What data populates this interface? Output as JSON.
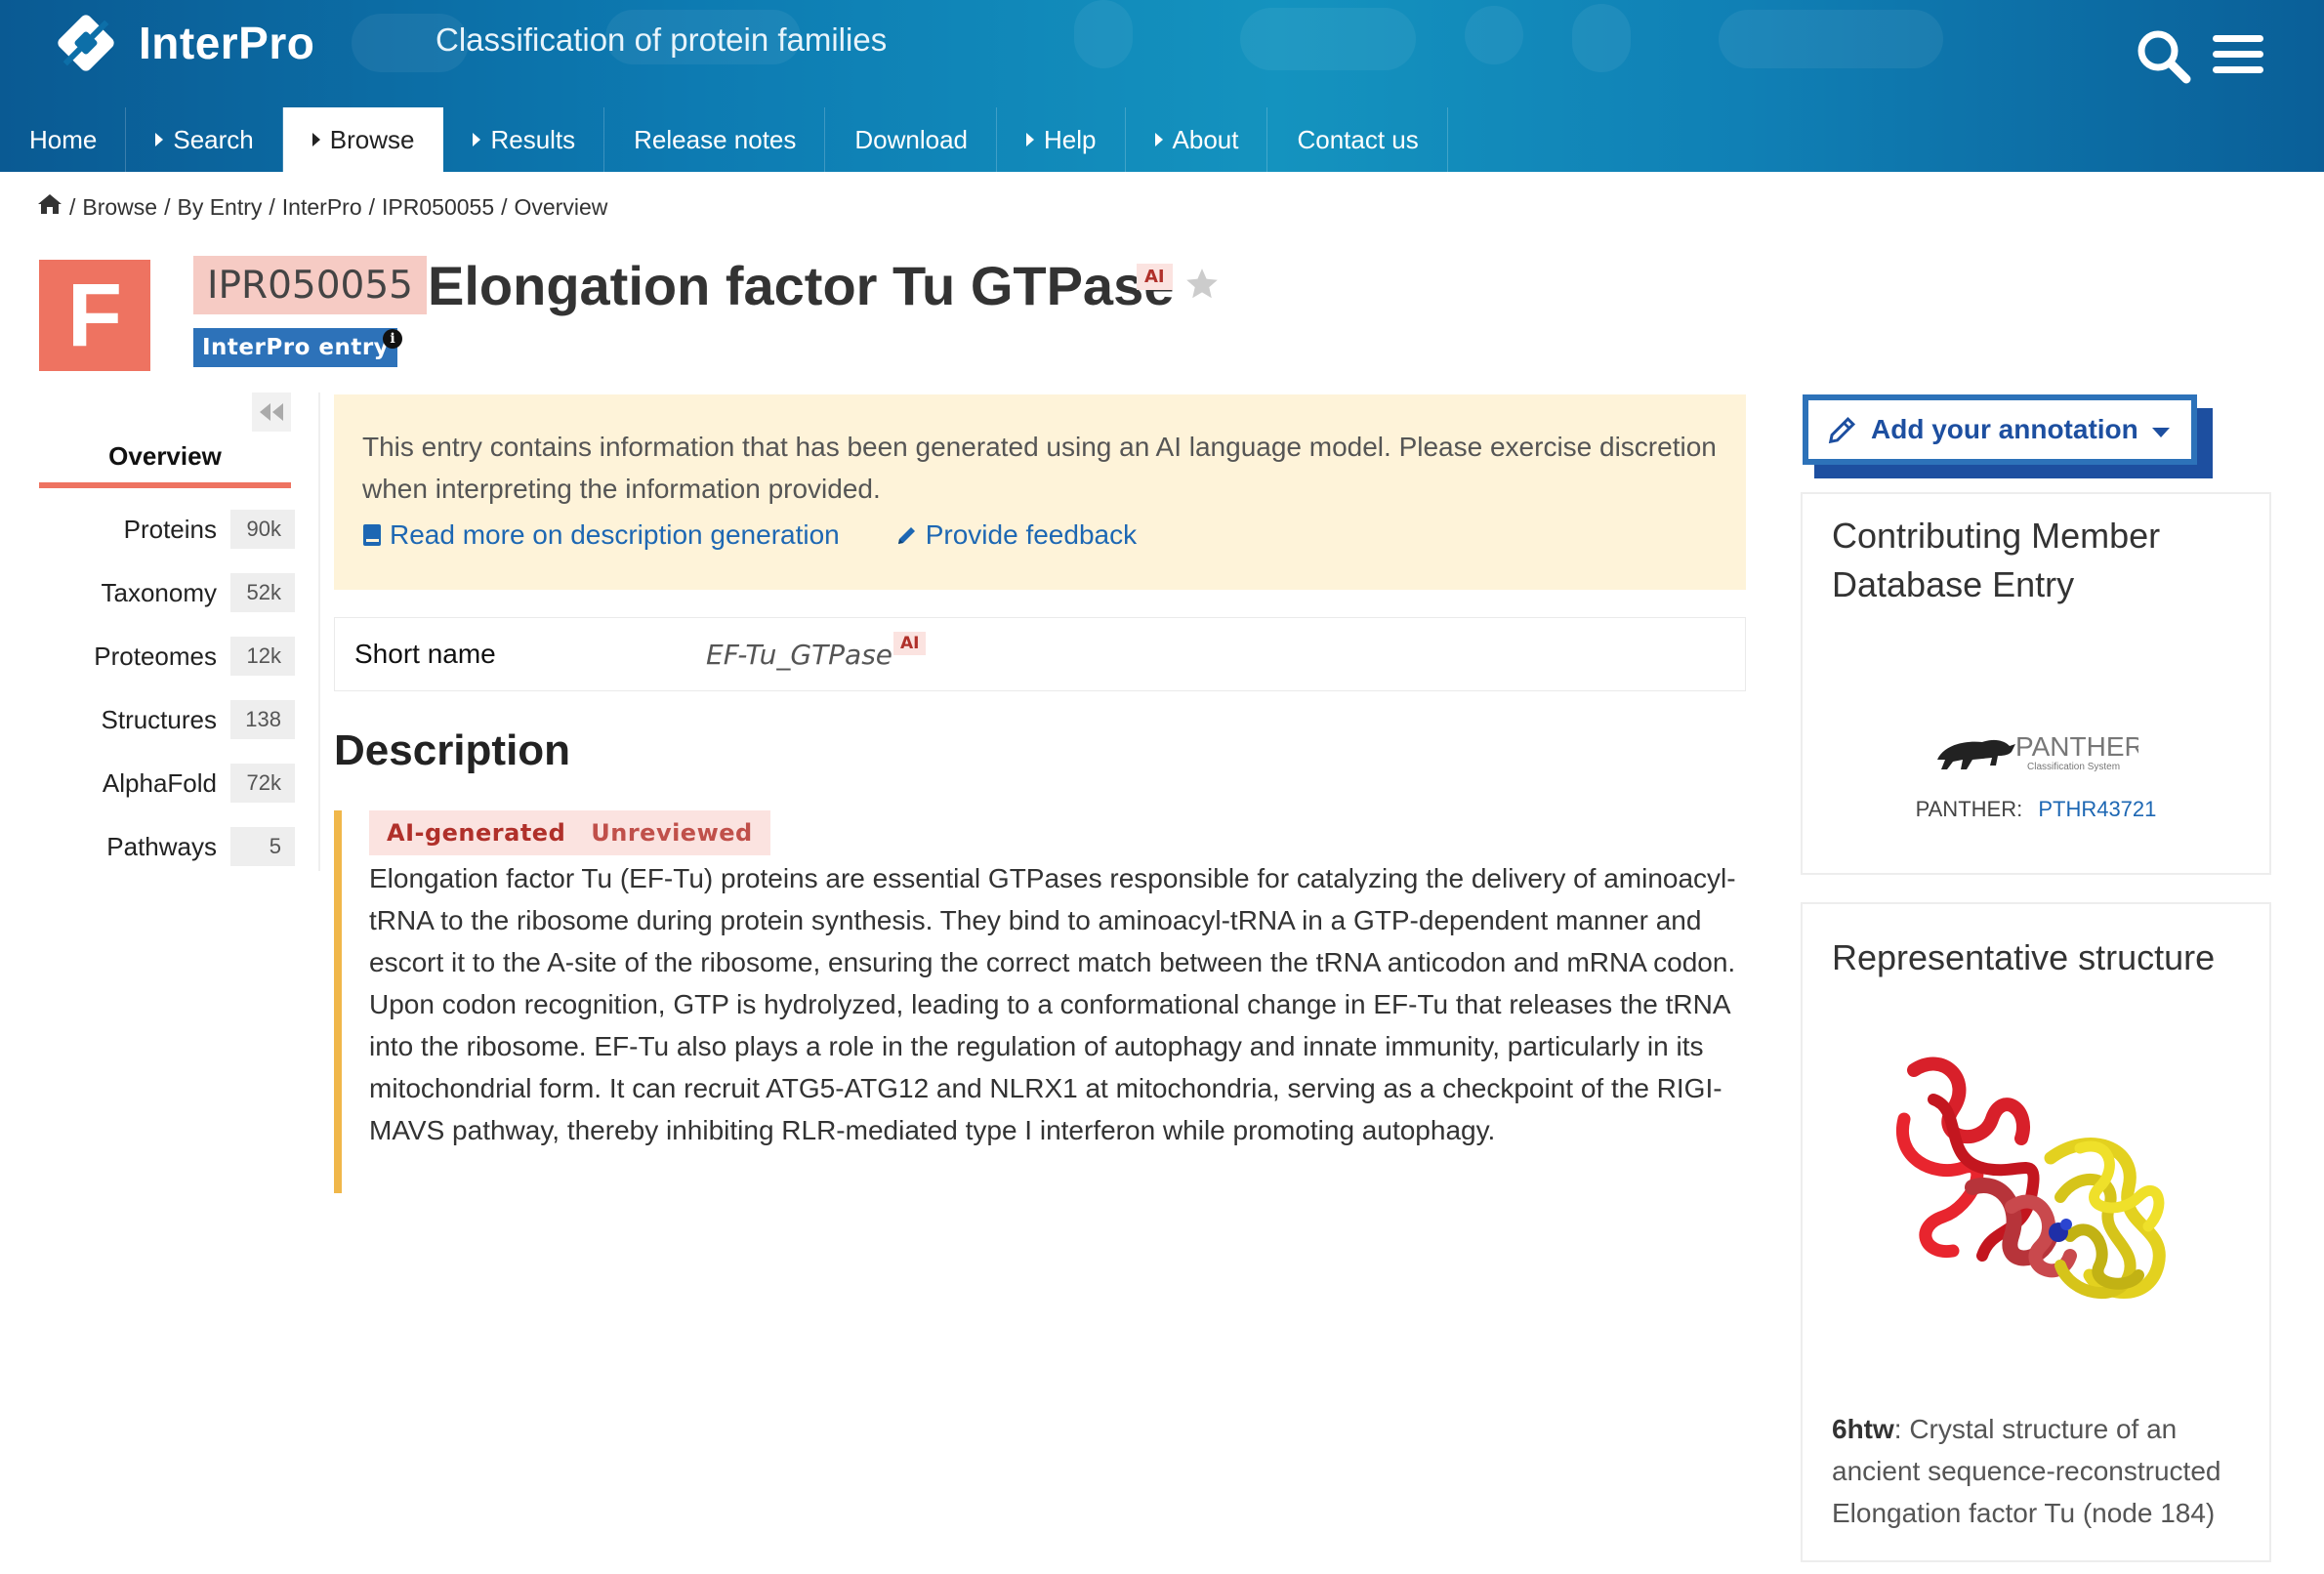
{
  "header": {
    "logo_text": "InterPro",
    "tagline": "Classification of protein families",
    "nav": [
      {
        "label": "Home",
        "caret": false,
        "active": false
      },
      {
        "label": "Search",
        "caret": true,
        "active": false
      },
      {
        "label": "Browse",
        "caret": true,
        "active": true
      },
      {
        "label": "Results",
        "caret": true,
        "active": false
      },
      {
        "label": "Release notes",
        "caret": false,
        "active": false
      },
      {
        "label": "Download",
        "caret": false,
        "active": false
      },
      {
        "label": "Help",
        "caret": true,
        "active": false
      },
      {
        "label": "About",
        "caret": true,
        "active": false
      },
      {
        "label": "Contact us",
        "caret": false,
        "active": false
      }
    ],
    "icons": [
      "search-icon",
      "menu-icon"
    ]
  },
  "breadcrumb": [
    "Browse",
    "By Entry",
    "InterPro",
    "IPR050055",
    "Overview"
  ],
  "entry": {
    "type_letter": "F",
    "accession": "IPR050055",
    "name": "Elongation factor Tu GTPase",
    "ai_tag": "AI",
    "type_label": "InterPro entry",
    "info_glyph": "i"
  },
  "sidebar": {
    "overview": "Overview",
    "items": [
      {
        "label": "Proteins",
        "count": "90k"
      },
      {
        "label": "Taxonomy",
        "count": "52k"
      },
      {
        "label": "Proteomes",
        "count": "12k"
      },
      {
        "label": "Structures",
        "count": "138"
      },
      {
        "label": "AlphaFold",
        "count": "72k"
      },
      {
        "label": "Pathways",
        "count": "5"
      }
    ]
  },
  "notice": {
    "text": "This entry contains information that has been generated using an AI language model. Please exercise discretion when interpreting the information provided.",
    "read_more": "Read more on description generation",
    "feedback": "Provide feedback"
  },
  "short_name": {
    "label": "Short name",
    "value": "EF-Tu_GTPase",
    "ai_tag": "AI"
  },
  "description": {
    "heading": "Description",
    "tag_ai": "AI-generated",
    "tag_review": "Unreviewed",
    "text": "Elongation factor Tu (EF-Tu) proteins are essential GTPases responsible for catalyzing the delivery of aminoacyl-tRNA to the ribosome during protein synthesis. They bind to aminoacyl-tRNA in a GTP-dependent manner and escort it to the A-site of the ribosome, ensuring the correct match between the tRNA anticodon and mRNA codon. Upon codon recognition, GTP is hydrolyzed, leading to a conformational change in EF-Tu that releases the tRNA into the ribosome. EF-Tu also plays a role in the regulation of autophagy and innate immunity, particularly in its mitochondrial form. It can recruit ATG5-ATG12 and NLRX1 at mitochondria, serving as a checkpoint of the RIGI-MAVS pathway, thereby inhibiting RLR-mediated type I interferon while promoting autophagy."
  },
  "right": {
    "annotation_button": "Add your annotation",
    "member_title": "Contributing Member Database Entry",
    "member_db": "PANTHER:",
    "member_acc": "PTHR43721",
    "panther_logo": {
      "name": "PANTHER",
      "sub": "Classification System"
    },
    "rep_title": "Representative structure",
    "rep_pdb": "6htw",
    "rep_desc": ": Crystal structure of an ancient sequence-reconstructed Elongation factor Tu (node 184)"
  },
  "colors": {
    "header_blue": "#0d7bb2",
    "type_badge": "#ee7361",
    "accession_bg": "#f6cbc4",
    "entry_label": "#2d72b9",
    "notice_bg": "#fef3d9",
    "desc_border": "#f0b74a",
    "ai_tag_text": "#b0302a",
    "link": "#1d67b3"
  }
}
